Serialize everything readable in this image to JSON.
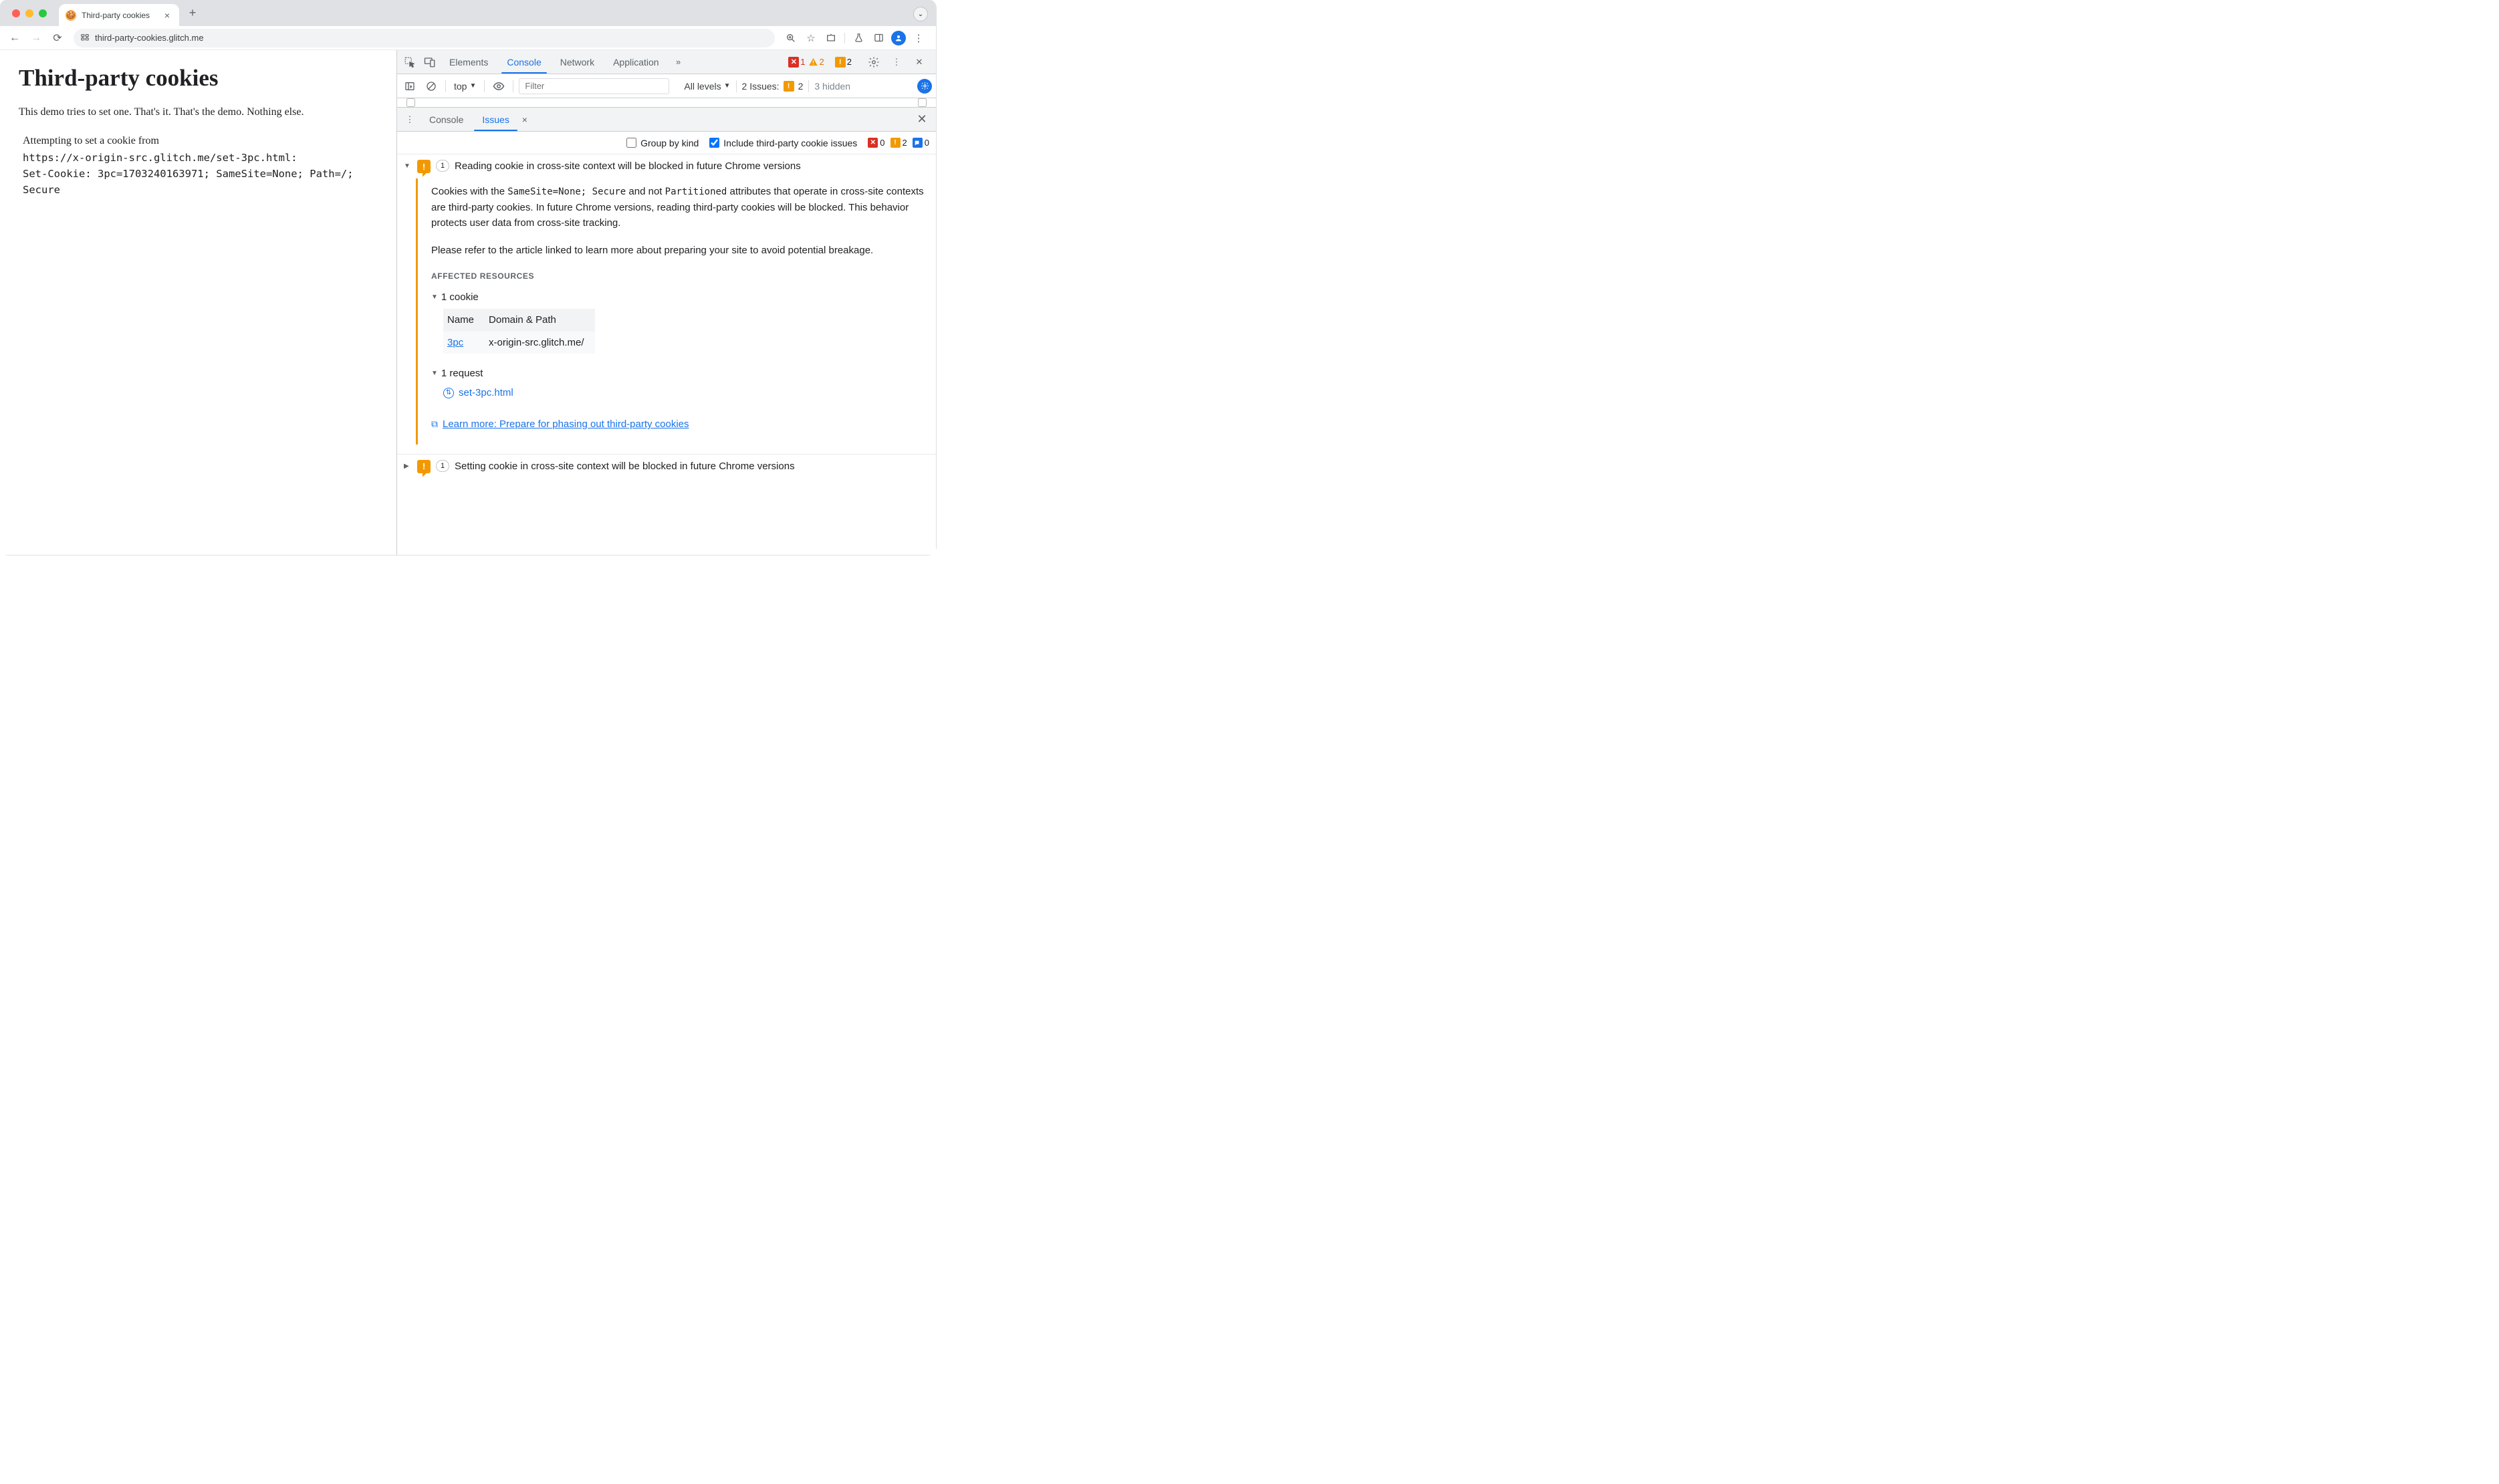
{
  "browser": {
    "tab_title": "Third-party cookies",
    "url": "third-party-cookies.glitch.me"
  },
  "page": {
    "h1": "Third-party cookies",
    "intro": "This demo tries to set one. That's it. That's the demo. Nothing else.",
    "line1": "Attempting to set a cookie from",
    "line2": "https://x-origin-src.glitch.me/set-3pc.html:",
    "line3": "Set-Cookie: 3pc=1703240163971; SameSite=None; Path=/; Secure"
  },
  "devtools": {
    "tabs": {
      "elements": "Elements",
      "console": "Console",
      "network": "Network",
      "application": "Application"
    },
    "errors": "1",
    "warnings": "2",
    "issues": "2",
    "toolbar": {
      "ctx": "top",
      "filter_placeholder": "Filter",
      "levels": "All levels",
      "issues_label": "2 Issues:",
      "issues_n": "2",
      "hidden": "3 hidden"
    },
    "drawer": {
      "console": "Console",
      "issues": "Issues"
    },
    "issues_bar": {
      "group": "Group by kind",
      "include": "Include third-party cookie issues",
      "b_err": "0",
      "b_warn": "2",
      "b_info": "0"
    },
    "issue1": {
      "count": "1",
      "title": "Reading cookie in cross-site context will be blocked in future Chrome versions",
      "p1a": "Cookies with the ",
      "p1_code1": "SameSite=None; Secure",
      "p1b": " and not ",
      "p1_code2": "Partitioned",
      "p1c": " attributes that operate in cross-site contexts are third-party cookies. In future Chrome versions, reading third-party cookies will be blocked. This behavior protects user data from cross-site tracking.",
      "p2": "Please refer to the article linked to learn more about preparing your site to avoid potential breakage.",
      "affected_heading": "AFFECTED RESOURCES",
      "cookie_summary": "1 cookie",
      "th_name": "Name",
      "th_domain": "Domain & Path",
      "td_name": "3pc",
      "td_domain": "x-origin-src.glitch.me/",
      "request_summary": "1 request",
      "request_name": "set-3pc.html",
      "learn": "Learn more: Prepare for phasing out third-party cookies"
    },
    "issue2": {
      "count": "1",
      "title": "Setting cookie in cross-site context will be blocked in future Chrome versions"
    }
  }
}
